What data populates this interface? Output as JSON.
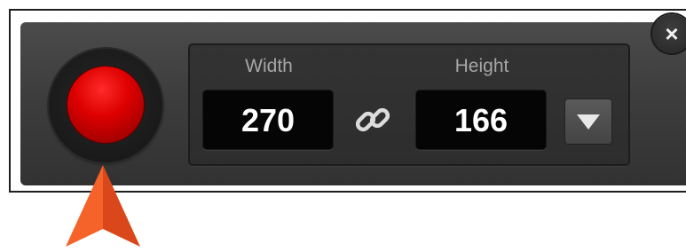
{
  "toolbar": {
    "record_button": {
      "icon": "record-icon",
      "color": "#d00000"
    },
    "dimensions": {
      "width_label": "Width",
      "height_label": "Height",
      "width_value": "270",
      "height_value": "166",
      "link_icon": "chain-link-icon",
      "dropdown_icon": "triangle-down-icon"
    },
    "close_button": {
      "icon": "close-icon",
      "glyph": "×"
    }
  },
  "annotation": {
    "icon": "orange-arrow-pointer",
    "color": "#f05a22"
  }
}
